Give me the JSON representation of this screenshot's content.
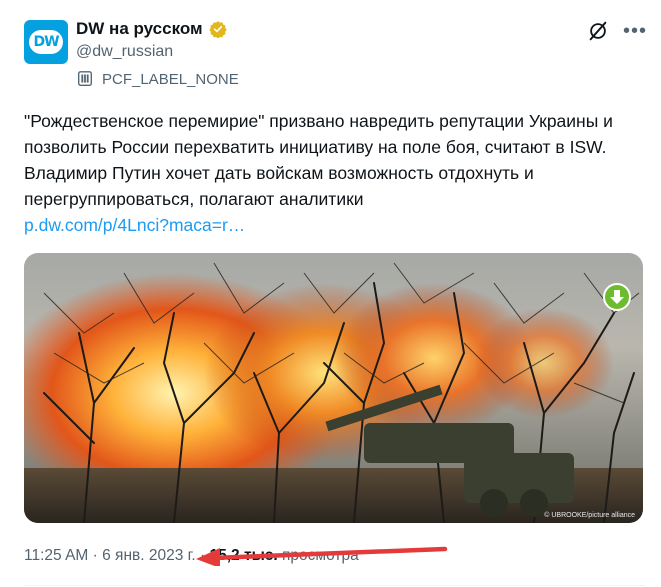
{
  "account": {
    "avatar_text": "DW",
    "display_name": "DW на русском",
    "handle": "@dw_russian",
    "label": "PCF_LABEL_NONE",
    "verified_color": "#e2b719"
  },
  "tweet": {
    "text": "\"Рождественское перемирие\" призвано навредить репутации Украины и позволить России перехватить инициативу на поле боя, считают в ISW. Владимир Путин хочет дать войскам возможность отдохнуть и перегруппироваться, полагают аналитики",
    "link": "p.dw.com/p/4Lnci?maca=r…"
  },
  "media": {
    "photo_credit": "© UBROOKE/picture alliance"
  },
  "meta": {
    "time": "11:25 AM",
    "separator": " · ",
    "date": "6 янв. 2023 г.",
    "separator2": " · ",
    "views": "15,2 тыс.",
    "views_label": " просмотра"
  },
  "colors": {
    "link": "#1d9bf0",
    "secondary_text": "#536471",
    "dw_blue": "#05a0e0",
    "annotation_arrow": "#e53a3a"
  },
  "icons": {
    "verified": "verified-badge-icon",
    "label": "government-label-icon",
    "grok": "grok-icon",
    "more": "more-icon",
    "download": "download-icon"
  }
}
